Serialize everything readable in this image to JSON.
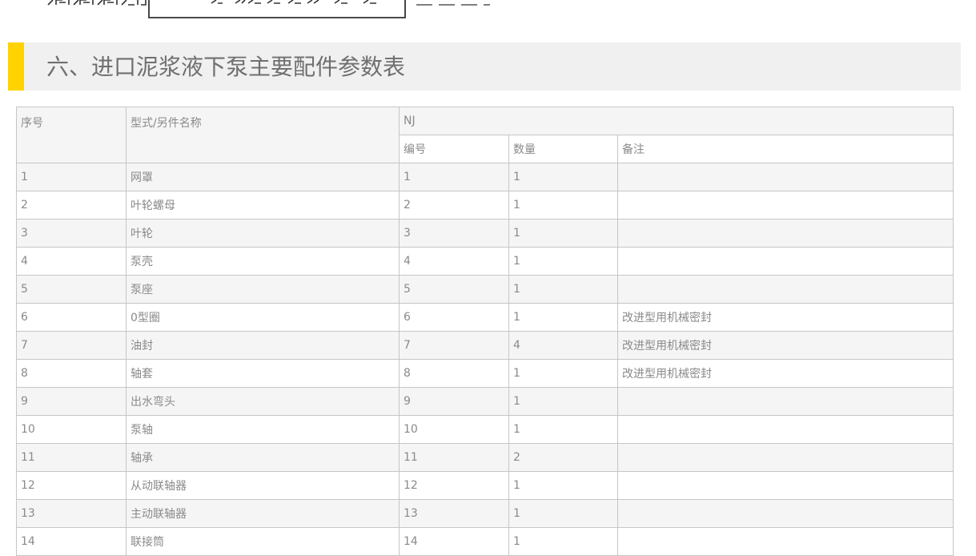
{
  "section": {
    "title": "六、进口泥浆液下泵主要配件参数表"
  },
  "table": {
    "headers": {
      "seq": "序号",
      "name": "型式/另件名称",
      "group": "NJ",
      "code": "编号",
      "qty": "数量",
      "note": "备注"
    },
    "rows": [
      {
        "seq": "1",
        "name": "网罩",
        "code": "1",
        "qty": "1",
        "note": ""
      },
      {
        "seq": "2",
        "name": "叶轮螺母",
        "code": "2",
        "qty": "1",
        "note": ""
      },
      {
        "seq": "3",
        "name": "叶轮",
        "code": "3",
        "qty": "1",
        "note": ""
      },
      {
        "seq": "4",
        "name": "泵壳",
        "code": "4",
        "qty": "1",
        "note": ""
      },
      {
        "seq": "5",
        "name": "泵座",
        "code": "5",
        "qty": "1",
        "note": ""
      },
      {
        "seq": "6",
        "name": "0型圈",
        "code": "6",
        "qty": "1",
        "note": "改进型用机械密封"
      },
      {
        "seq": "7",
        "name": "油封",
        "code": "7",
        "qty": "4",
        "note": "改进型用机械密封"
      },
      {
        "seq": "8",
        "name": "轴套",
        "code": "8",
        "qty": "1",
        "note": "改进型用机械密封"
      },
      {
        "seq": "9",
        "name": "出水弯头",
        "code": "9",
        "qty": "1",
        "note": ""
      },
      {
        "seq": "10",
        "name": "泵轴",
        "code": "10",
        "qty": "1",
        "note": ""
      },
      {
        "seq": "11",
        "name": "轴承",
        "code": "11",
        "qty": "2",
        "note": ""
      },
      {
        "seq": "12",
        "name": "从动联轴器",
        "code": "12",
        "qty": "1",
        "note": ""
      },
      {
        "seq": "13",
        "name": "主动联轴器",
        "code": "13",
        "qty": "1",
        "note": ""
      },
      {
        "seq": "14",
        "name": "联接筒",
        "code": "14",
        "qty": "1",
        "note": ""
      }
    ]
  },
  "colors": {
    "accent": "#ffd200",
    "header_bg": "#f0f0f0",
    "text": "#8a8a8a",
    "border": "#c6c6c6",
    "row_alt": "#f5f5f5"
  }
}
